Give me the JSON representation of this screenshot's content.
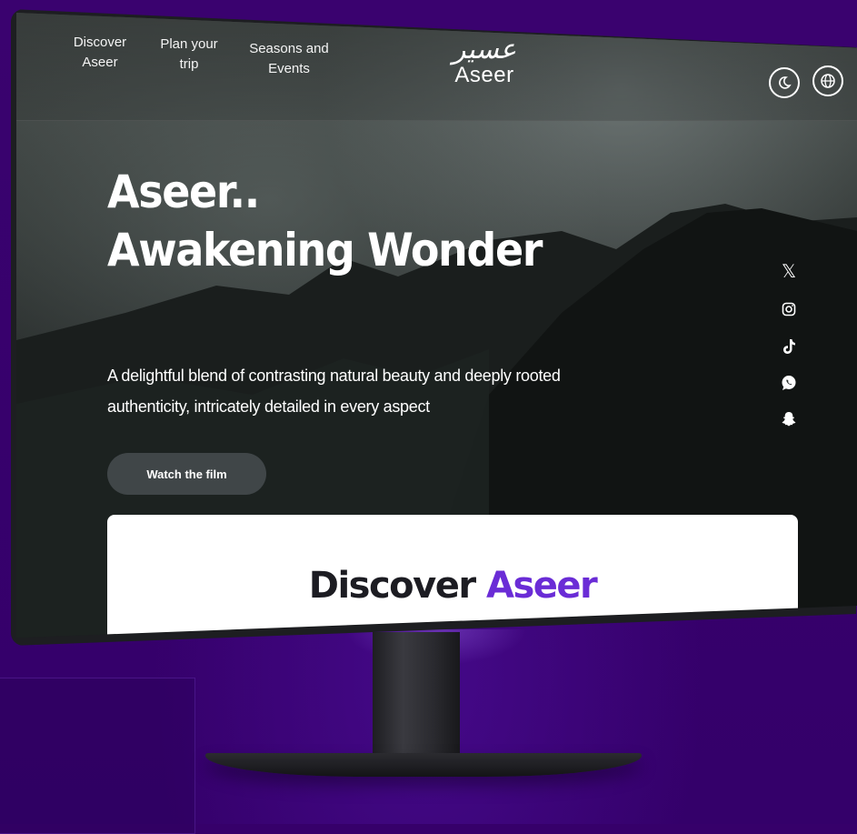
{
  "nav": {
    "items": [
      {
        "line1": "Discover",
        "line2": "Aseer"
      },
      {
        "line1": "Plan your",
        "line2": "trip"
      },
      {
        "line1": "Seasons and",
        "line2": "Events"
      }
    ]
  },
  "logo": {
    "arabic": "عسير",
    "english": "Aseer"
  },
  "header_buttons": {
    "theme_icon": "moon-icon",
    "language_icon": "globe-icon"
  },
  "hero": {
    "title_line1": "Aseer..",
    "title_line2": "Awakening Wonder",
    "description": "A delightful blend of contrasting natural beauty and deeply rooted authenticity, intricately detailed in every aspect",
    "button_label": "Watch the film"
  },
  "social": [
    "x-icon",
    "instagram-icon",
    "tiktok-icon",
    "whatsapp-icon",
    "snapchat-icon"
  ],
  "discover_card": {
    "title_part1": "Discover",
    "title_part2": "Aseer"
  },
  "colors": {
    "background": "#36006a",
    "accent": "#6a2cd6"
  }
}
